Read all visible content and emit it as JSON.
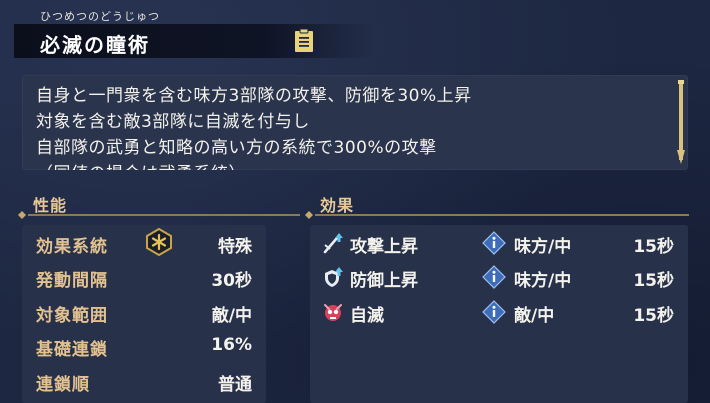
{
  "header": {
    "furigana": "ひつめつのどうじゅつ",
    "title": "必滅の瞳術",
    "memo_icon": "memo-icon"
  },
  "description": {
    "lines": [
      "自身と一門衆を含む味方3部隊の攻撃、防御を30%上昇",
      "対象を含む敵3部隊に自滅を付与し",
      "自部隊の武勇と知略の高い方の系統で300%の攻撃",
      "（同値の場合は武勇系統）"
    ]
  },
  "performance": {
    "heading": "性能",
    "rows": [
      {
        "label": "効果系統",
        "value": "特殊",
        "icon": "special-type-icon"
      },
      {
        "label": "発動間隔",
        "value": "30秒"
      },
      {
        "label": "対象範囲",
        "value": "敵/中"
      },
      {
        "label": "基礎連鎖",
        "value": "16%"
      },
      {
        "label": "連鎖順",
        "value": "普通"
      }
    ]
  },
  "effects": {
    "heading": "効果",
    "rows": [
      {
        "icon": "attack-up-icon",
        "name": "攻撃上昇",
        "target": "味方/中",
        "duration": "15秒"
      },
      {
        "icon": "defense-up-icon",
        "name": "防御上昇",
        "target": "味方/中",
        "duration": "15秒"
      },
      {
        "icon": "self-destruct-icon",
        "name": "自滅",
        "target": "敵/中",
        "duration": "15秒"
      }
    ]
  },
  "colors": {
    "background": "#1d2741",
    "panel": "#27314a",
    "label_gold": "#e3c290",
    "text": "#f4f2ec"
  }
}
